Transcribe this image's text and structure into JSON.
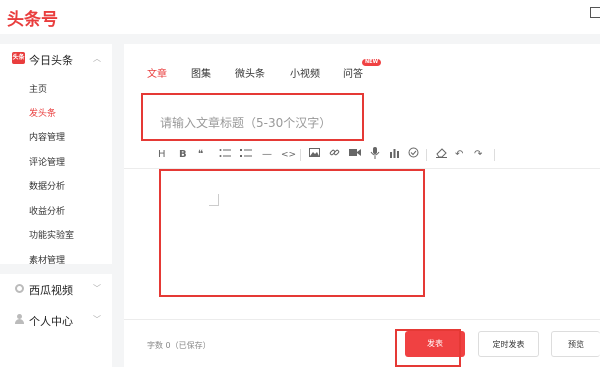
{
  "header": {
    "logo": "头条号"
  },
  "sidebar": {
    "group1": {
      "badge": "头条",
      "title": "今日头条",
      "expanded": true
    },
    "items": [
      "主页",
      "发头条",
      "内容管理",
      "评论管理",
      "数据分析",
      "收益分析",
      "功能实验室",
      "素材管理"
    ],
    "active_item": "发头条",
    "group2": {
      "title": "西瓜视频"
    },
    "group3": {
      "title": "个人中心"
    }
  },
  "editor": {
    "tabs": [
      "文章",
      "图集",
      "微头条",
      "小视频",
      "问答"
    ],
    "active_tab": "文章",
    "new_badge": "NEW",
    "title_placeholder": "请输入文章标题（5-30个汉字）",
    "toolbar_icons": [
      "heading-icon",
      "bold-icon",
      "quote-icon",
      "unordered-list-icon",
      "ordered-list-icon",
      "horizontal-rule-icon",
      "code-icon",
      "image-icon",
      "link-icon",
      "video-icon",
      "audio-icon",
      "chart-icon",
      "vote-icon",
      "eraser-icon",
      "undo-icon",
      "redo-icon"
    ],
    "toolbar_glyphs": {
      "heading": "H",
      "bold": "B",
      "quote": "❝",
      "code": "<>",
      "hr": "—",
      "undo": "↶",
      "redo": "↷"
    }
  },
  "footer": {
    "word_count": "字数 0（已保存）",
    "publish_label": "发表",
    "schedule_label": "定时发表",
    "preview_label": "预览"
  },
  "colors": {
    "brand_red": "#e93d3d",
    "highlight_red": "#e53935"
  }
}
